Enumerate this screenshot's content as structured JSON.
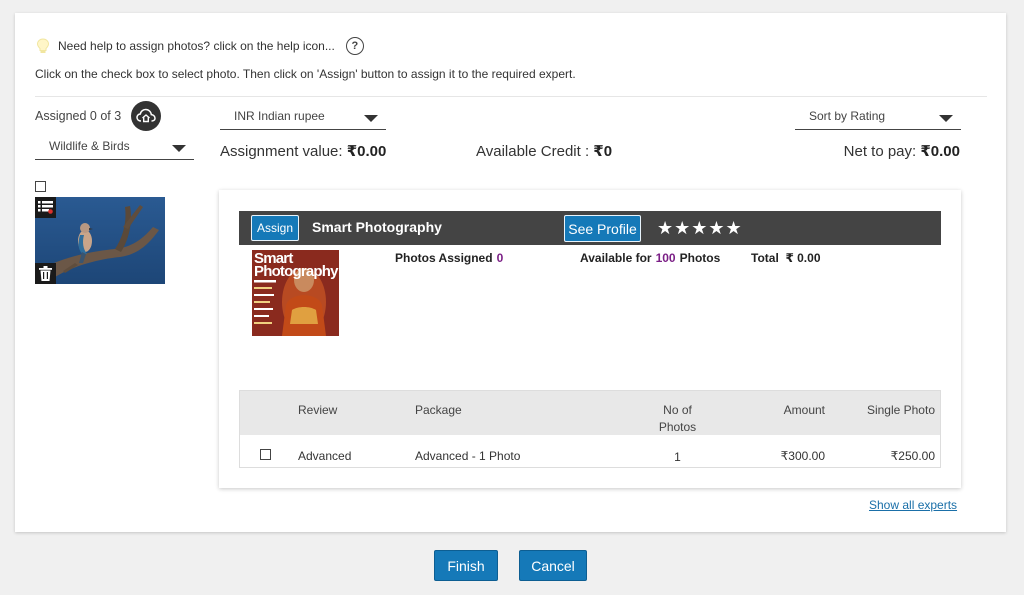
{
  "help": {
    "text": "Need help to assign photos? click on the help icon...",
    "icon": "question-icon",
    "icon_glyph": "?"
  },
  "instructions": "Click on the check box to select photo. Then click on 'Assign' button to assign it to the required expert.",
  "assigned": {
    "label": "Assigned 0 of 3",
    "icon": "cloud-home-icon"
  },
  "filters": {
    "category": "Wildlife & Birds",
    "currency": "INR Indian rupee",
    "sort": "Sort by Rating"
  },
  "summary": {
    "assignment_label": "Assignment value: ",
    "assignment_value": "₹0.00",
    "credit_label": "Available Credit : ",
    "credit_value": "₹0",
    "net_label": "Net to pay: ",
    "net_value": "₹0.00"
  },
  "expert": {
    "assign_label": "Assign",
    "name": "Smart Photography",
    "profile_label": "See Profile",
    "stars": "★★★★★",
    "rating": 5,
    "photos_assigned_label": "Photos Assigned",
    "photos_assigned_value": "0",
    "available_label": "Available for",
    "available_value": "100",
    "available_suffix": "Photos",
    "total_label": "Total",
    "total_value": "₹ 0.00",
    "magazine_title": "Smart Photography"
  },
  "table": {
    "headers": {
      "review": "Review",
      "package": "Package",
      "noof": "No of Photos",
      "amount": "Amount",
      "single": "Single Photo"
    },
    "rows": [
      {
        "review": "Advanced",
        "package": "Advanced - 1 Photo",
        "noof": "1",
        "amount": "₹300.00",
        "single": "₹250.00"
      }
    ]
  },
  "show_all": "Show all experts",
  "buttons": {
    "finish": "Finish",
    "cancel": "Cancel"
  },
  "colors": {
    "accent": "#1579b8",
    "bar": "#444444",
    "highlight": "#7b1f86"
  }
}
